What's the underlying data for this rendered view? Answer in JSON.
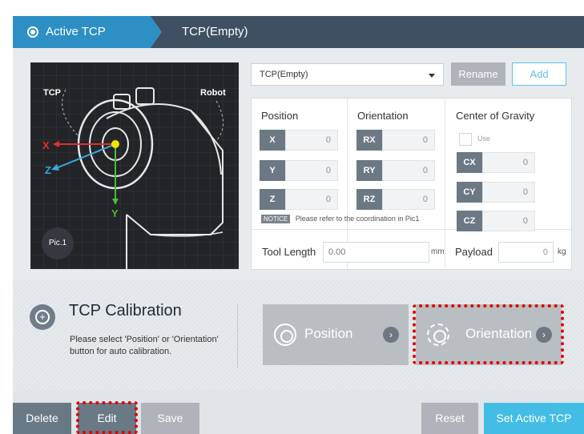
{
  "header": {
    "active_label": "Active TCP",
    "tcp_name": "TCP(Empty)"
  },
  "picture": {
    "tcp_label": "TCP",
    "robot_label": "Robot",
    "x_axis": "X",
    "y_axis": "Y",
    "z_axis": "Z",
    "badge": "Pic.1"
  },
  "selector": {
    "selected": "TCP(Empty)",
    "rename_label": "Rename",
    "add_label": "Add"
  },
  "position": {
    "title": "Position",
    "fields": [
      {
        "tag": "X",
        "value": "0"
      },
      {
        "tag": "Y",
        "value": "0"
      },
      {
        "tag": "Z",
        "value": "0"
      }
    ]
  },
  "orientation": {
    "title": "Orientation",
    "fields": [
      {
        "tag": "RX",
        "value": "0"
      },
      {
        "tag": "RY",
        "value": "0"
      },
      {
        "tag": "RZ",
        "value": "0"
      }
    ]
  },
  "gravity": {
    "title": "Center of Gravity",
    "use_label": "Use",
    "fields": [
      {
        "tag": "CX",
        "value": "0"
      },
      {
        "tag": "CY",
        "value": "0"
      },
      {
        "tag": "CZ",
        "value": "0"
      }
    ]
  },
  "notice": {
    "tag": "NOTICE",
    "text": "Please refer to the coordination in Pic1"
  },
  "tool_length": {
    "label": "Tool Length",
    "placeholder": "0.00",
    "unit": "mm"
  },
  "payload": {
    "label": "Payload",
    "value": "0",
    "unit": "kg"
  },
  "calibration": {
    "title": "TCP Calibration",
    "description": "Please select 'Position' or 'Orientation' button for auto calibration.",
    "position_label": "Position",
    "orientation_label": "Orientation",
    "plus": "+",
    "go": "›"
  },
  "actions": {
    "delete": "Delete",
    "edit": "Edit",
    "save": "Save",
    "reset": "Reset",
    "set_active": "Set Active TCP"
  },
  "colors": {
    "header_bg": "#3e5061",
    "accent_blue": "#2d8fc4",
    "set_active_bg": "#43bde5",
    "highlight_red": "#e00000"
  }
}
